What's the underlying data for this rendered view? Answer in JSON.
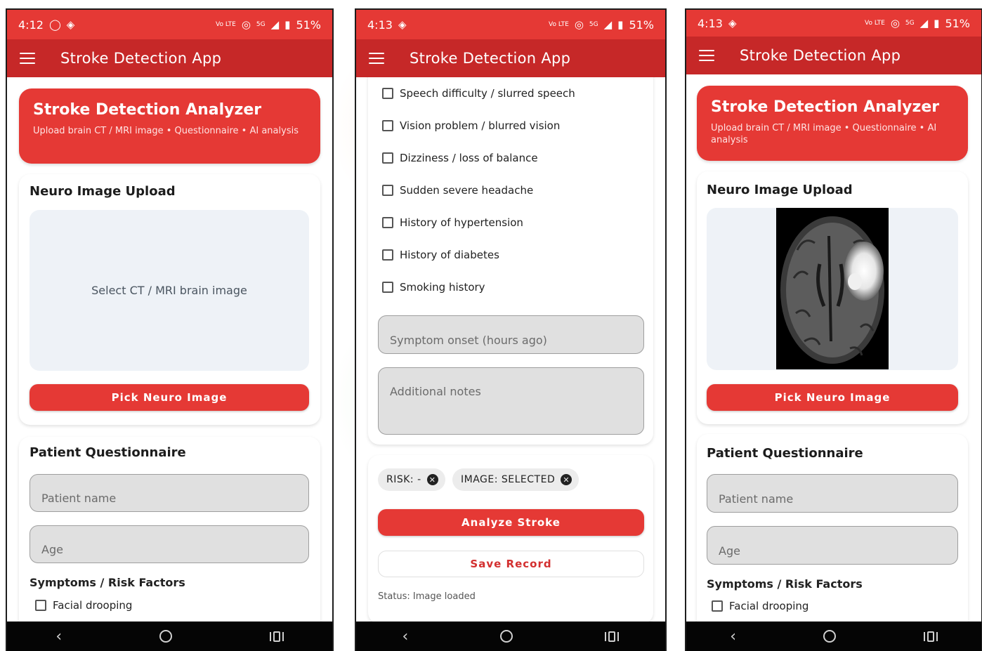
{
  "colors": {
    "primary": "#e53935",
    "primary_dark": "#c62828",
    "card_bg": "#ffffff",
    "field_bg": "#e0e0e0",
    "upload_bg": "#eef2f7"
  },
  "status_bars": [
    {
      "time": "4:12",
      "left_icons": [
        "whatsapp-icon",
        "location-icon"
      ],
      "battery": "51%"
    },
    {
      "time": "4:13",
      "left_icons": [
        "location-icon"
      ],
      "battery": "51%"
    },
    {
      "time": "4:13",
      "left_icons": [
        "location-icon"
      ],
      "battery": "51%"
    }
  ],
  "status_small": {
    "volte": "Vo LTE",
    "net": "5G"
  },
  "toolbar": {
    "title": "Stroke Detection App",
    "menu_icon": "hamburger-menu-icon"
  },
  "header": {
    "title": "Stroke Detection Analyzer",
    "subtitle": "Upload brain CT / MRI image • Questionnaire • AI analysis"
  },
  "upload": {
    "section_title": "Neuro Image Upload",
    "placeholder": "Select CT / MRI brain image",
    "button_label": "Pick Neuro Image"
  },
  "questionnaire": {
    "section_title": "Patient Questionnaire",
    "name_placeholder": "Patient name",
    "age_placeholder": "Age",
    "symptoms_label": "Symptoms / Risk Factors",
    "checkboxes": [
      {
        "label": "Facial drooping",
        "checked": false
      },
      {
        "label": "Speech difficulty / slurred speech",
        "checked": false
      },
      {
        "label": "Vision problem / blurred vision",
        "checked": false
      },
      {
        "label": "Dizziness / loss of balance",
        "checked": false
      },
      {
        "label": "Sudden severe headache",
        "checked": false
      },
      {
        "label": "History of hypertension",
        "checked": false
      },
      {
        "label": "History of diabetes",
        "checked": false
      },
      {
        "label": "Smoking history",
        "checked": false
      }
    ],
    "onset_placeholder": "Symptom onset (hours ago)",
    "notes_placeholder": "Additional notes"
  },
  "analysis": {
    "chips": [
      {
        "label": "RISK: -"
      },
      {
        "label": "IMAGE: SELECTED"
      }
    ],
    "analyze_label": "Analyze Stroke",
    "save_label": "Save Record",
    "status": "Status: Image loaded"
  },
  "nav": {
    "back_icon": "back-icon",
    "home_icon": "home-icon",
    "recents_icon": "recents-icon"
  }
}
